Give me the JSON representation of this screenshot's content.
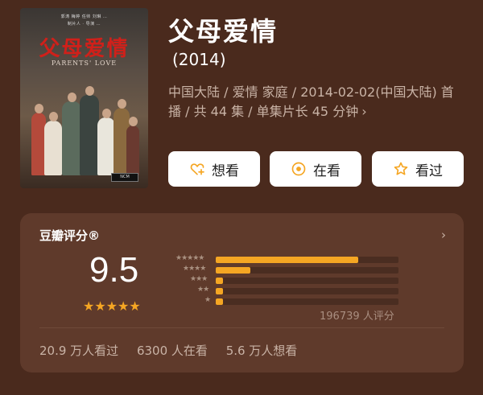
{
  "poster": {
    "title_cn": "父母爱情",
    "title_en": "PARENTS' LOVE",
    "credits_line1": "郭涛 梅婷 任帅 刘琳 …",
    "credits_line2": "制片人 · 导演 …",
    "badge": "NCM"
  },
  "header": {
    "title": "父母爱情",
    "year": "(2014)",
    "meta": "中国大陆 / 爱情 家庭 / 2014-02-02(中国大陆) 首播 / 共 44 集 / 单集片长 45 分钟",
    "meta_chevron": "›"
  },
  "actions": {
    "want_label": "想看",
    "doing_label": "在看",
    "done_label": "看过"
  },
  "rating": {
    "section_title": "豆瓣评分®",
    "chevron": "›",
    "score": "9.5",
    "score_stars": "★★★★★",
    "rating_count": "196739 人评分",
    "distribution": [
      {
        "stars": "★★★★★",
        "fraction": 0.78
      },
      {
        "stars": "★★★★",
        "fraction": 0.19
      },
      {
        "stars": "★★★",
        "fraction": 0.03
      },
      {
        "stars": "★★",
        "fraction": 0.02
      },
      {
        "stars": "★",
        "fraction": 0.02
      }
    ],
    "accent": "#f5a623"
  },
  "stats": {
    "watched": "20.9 万人看过",
    "watching": "6300 人在看",
    "want": "5.6 万人想看"
  }
}
